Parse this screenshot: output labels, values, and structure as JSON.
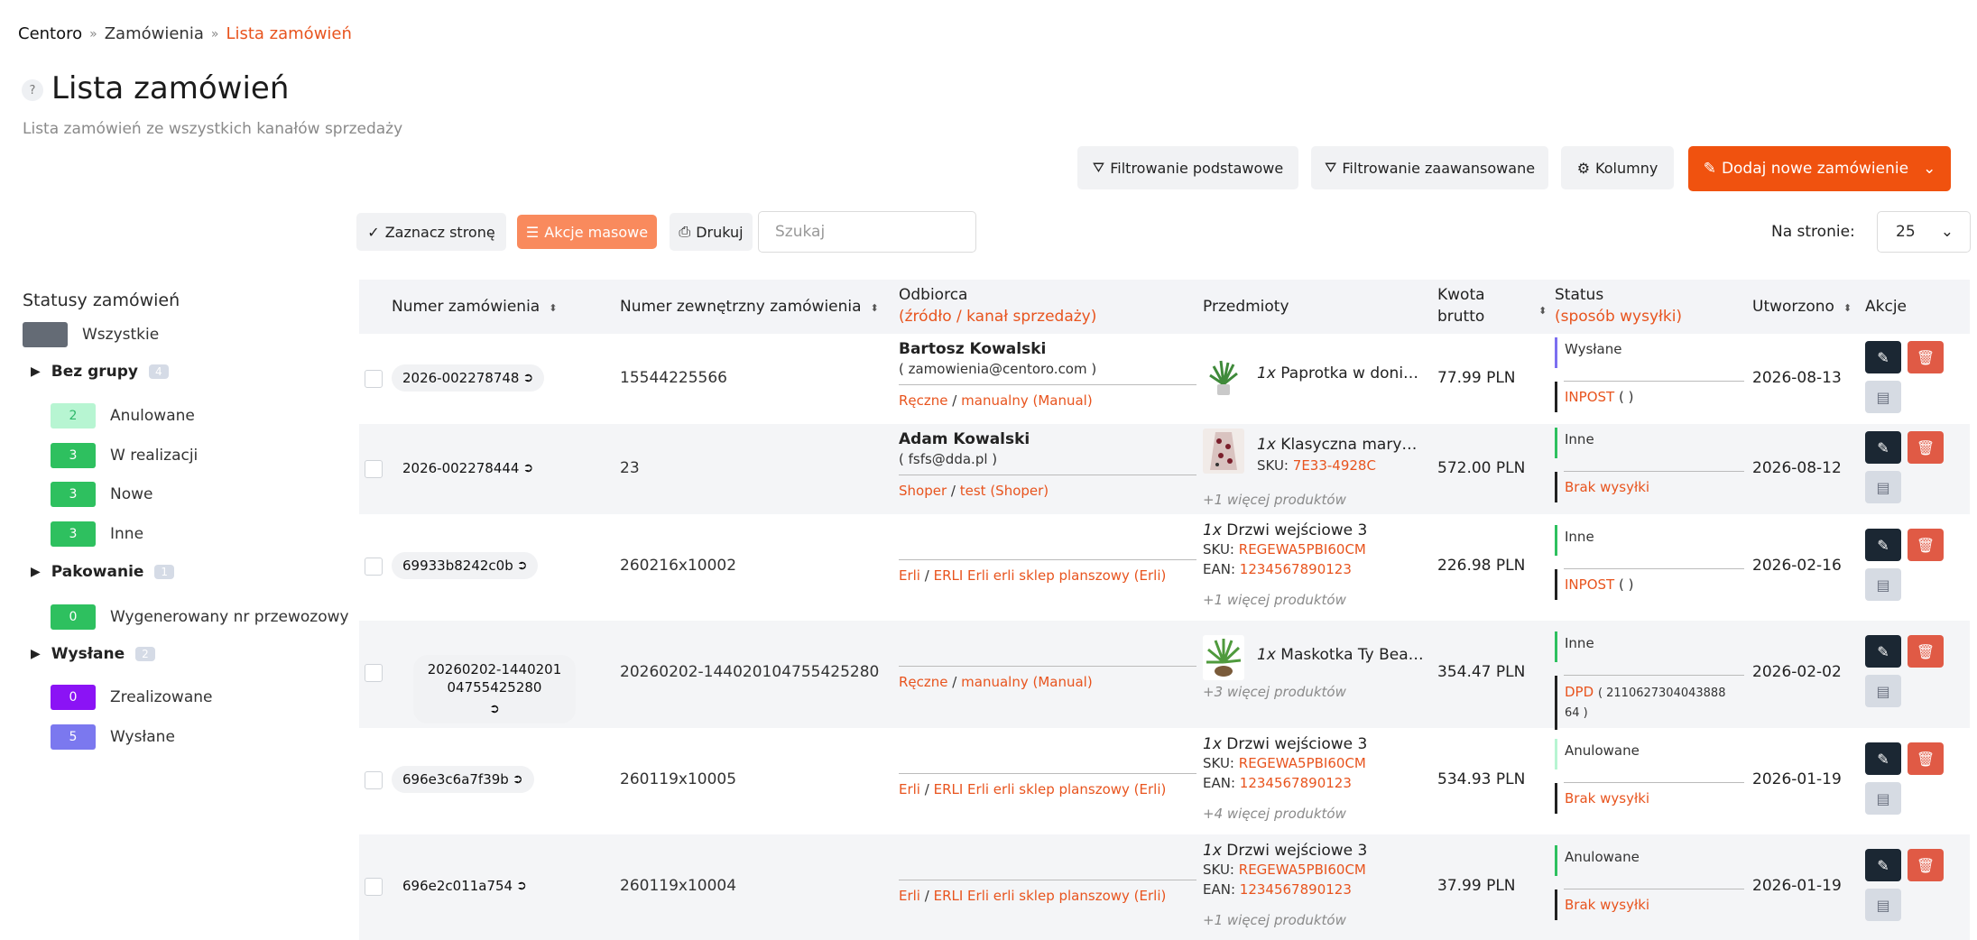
{
  "breadcrumb": [
    "Centoro",
    "Zamówienia",
    "Lista zamówień"
  ],
  "page": {
    "help": "?",
    "title": "Lista zamówień",
    "subtitle": "Lista zamówień ze wszystkich kanałów sprzedaży"
  },
  "toolbar": {
    "filter_basic": "Filtrowanie podstawowe",
    "filter_advanced": "Filtrowanie zaawansowane",
    "columns": "Kolumny",
    "add_order": "Dodaj nowe zamówienie",
    "select_page": "Zaznacz stronę",
    "bulk_actions": "Akcje masowe",
    "print": "Drukuj",
    "search_placeholder": "Szukaj",
    "per_page_label": "Na stronie:",
    "per_page_value": "25"
  },
  "sidebar": {
    "title": "Statusy zamówień",
    "all": "Wszystkie",
    "groups": [
      {
        "name": "Bez grupy",
        "count": "4",
        "statuses": [
          {
            "count": "2",
            "label": "Anulowane",
            "color": "#b7f5d2",
            "text_color": "#2fb86a"
          },
          {
            "count": "3",
            "label": "W realizacji",
            "color": "#2ec05f",
            "text_color": "#ffffff"
          },
          {
            "count": "3",
            "label": "Nowe",
            "color": "#2ec05f",
            "text_color": "#ffffff"
          },
          {
            "count": "3",
            "label": "Inne",
            "color": "#2ec05f",
            "text_color": "#ffffff"
          }
        ]
      },
      {
        "name": "Pakowanie",
        "count": "1",
        "statuses": [
          {
            "count": "0",
            "label": "Wygenerowany nr przewozowy",
            "color": "#2ec05f",
            "text_color": "#ffffff"
          }
        ]
      },
      {
        "name": "Wysłane",
        "count": "2",
        "statuses": [
          {
            "count": "0",
            "label": "Zrealizowane",
            "color": "#8b13f5",
            "text_color": "#ffffff"
          },
          {
            "count": "5",
            "label": "Wysłane",
            "color": "#7b78ef",
            "text_color": "#ffffff"
          }
        ]
      }
    ]
  },
  "table": {
    "headers": {
      "order_no": "Numer zamówienia",
      "ext_no": "Numer zewnętrzny zamówienia",
      "recipient": "Odbiorca",
      "recipient_sub": "(źródło / kanał sprzedaży)",
      "items": "Przedmioty",
      "amount_1": "Kwota",
      "amount_2": "brutto",
      "status": "Status",
      "status_sub": "(sposób wysyłki)",
      "created": "Utworzono",
      "actions": "Akcje"
    },
    "rows": [
      {
        "order": "2026-002278748",
        "ext": "15544225566",
        "name": "Bartosz Kowalski",
        "email": "( zamowienia@centoro.com )",
        "source": "Ręczne",
        "channel": "manualny (Manual)",
        "qty": "1x",
        "item": "Paprotka w donic…",
        "sku": "",
        "ean": "",
        "more": "",
        "price": "77.99 PLN",
        "status": "Wysłane",
        "shipping": "INPOST",
        "shipping_extra": "( )",
        "date": "2026-08-13"
      },
      {
        "order": "2026-002278444",
        "ext": "23",
        "name": "Adam Kowalski",
        "email": "( fsfs@dda.pl )",
        "source": "Shoper",
        "channel": "test (Shoper)",
        "qty": "1x",
        "item": "Klasyczna maryna…",
        "sku": "7E33-4928C",
        "ean": "",
        "more": "+1 więcej produktów",
        "price": "572.00 PLN",
        "status": "Inne",
        "shipping": "Brak wysyłki",
        "shipping_extra": "",
        "date": "2026-08-12"
      },
      {
        "order": "69933b8242c0b",
        "ext": "260216x10002",
        "name": "",
        "email": "",
        "source": "Erli",
        "channel": "ERLI Erli erli sklep planszowy (Erli)",
        "qty": "1x",
        "item": "Drzwi wejściowe 3",
        "sku": "REGEWA5PBI60CM",
        "ean": "1234567890123",
        "more": "+1 więcej produktów",
        "price": "226.98 PLN",
        "status": "Inne",
        "shipping": "INPOST",
        "shipping_extra": "( )",
        "date": "2026-02-16"
      },
      {
        "order": "20260202-144020104755425280",
        "ext": "20260202-144020104755425280",
        "name": "",
        "email": "",
        "source": "Ręczne",
        "channel": "manualny (Manual)",
        "qty": "1x",
        "item": "Maskotka Ty Bean…",
        "sku": "",
        "ean": "",
        "more": "+3 więcej produktów",
        "price": "354.47 PLN",
        "status": "Inne",
        "shipping": "DPD",
        "shipping_extra": "( 2110627304043888 64 )",
        "date": "2026-02-02"
      },
      {
        "order": "696e3c6a7f39b",
        "ext": "260119x10005",
        "name": "",
        "email": "",
        "source": "Erli",
        "channel": "ERLI Erli erli sklep planszowy (Erli)",
        "qty": "1x",
        "item": "Drzwi wejściowe 3",
        "sku": "REGEWA5PBI60CM",
        "ean": "1234567890123",
        "more": "+4 więcej produktów",
        "price": "534.93 PLN",
        "status": "Anulowane",
        "shipping": "Brak wysyłki",
        "shipping_extra": "",
        "date": "2026-01-19"
      },
      {
        "order": "696e2c011a754",
        "ext": "260119x10004",
        "name": "",
        "email": "",
        "source": "Erli",
        "channel": "ERLI Erli erli sklep planszowy (Erli)",
        "qty": "1x",
        "item": "Drzwi wejściowe 3",
        "sku": "REGEWA5PBI60CM",
        "ean": "1234567890123",
        "more": "+1 więcej produktów",
        "price": "37.99 PLN",
        "status": "Anulowane",
        "shipping": "Brak wysyłki",
        "shipping_extra": "",
        "date": "2026-01-19"
      }
    ],
    "labels": {
      "sku": "SKU:",
      "ean": "EAN:",
      "slash": "/"
    }
  }
}
